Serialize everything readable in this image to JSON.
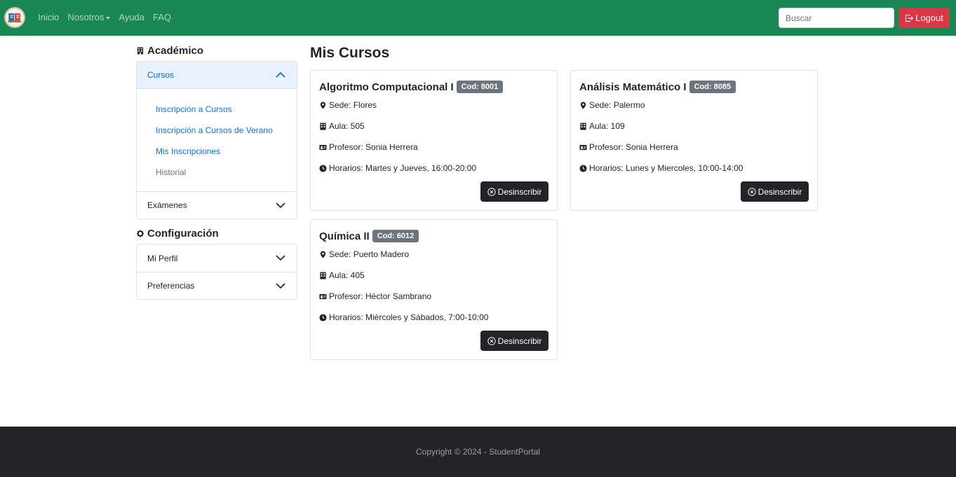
{
  "navbar": {
    "logo": "student-portal-logo",
    "links": [
      "Inicio",
      "Nosotros",
      "Ayuda",
      "FAQ"
    ],
    "search_placeholder": "Buscar",
    "logout_label": "Logout",
    "background": "#198754"
  },
  "sidebar": {
    "academico": {
      "title": "Académico",
      "cursos": {
        "label": "Cursos",
        "expanded": true,
        "items": [
          "Inscripción a Cursos",
          "Inscripción a Cursos de Verano",
          "Mis Inscripciones",
          "Historial"
        ]
      },
      "examenes": {
        "label": "Exámenes",
        "expanded": false
      }
    },
    "configuracion": {
      "title": "Configuración",
      "items": [
        {
          "label": "Mi Perfil",
          "expanded": false
        },
        {
          "label": "Preferencias",
          "expanded": false
        }
      ]
    }
  },
  "main": {
    "title": "Mis Cursos",
    "courses": [
      {
        "name": "Algoritmo Computacional I",
        "code": "Cod: 8001",
        "sede": "Sede: Flores",
        "aula": "Aula: 505",
        "profesor": "Profesor: Sonia Herrera",
        "horarios": "Horarios: Martes y Jueves, 16:00-20:00",
        "button": "Desinscribir"
      },
      {
        "name": "Análisis Matemático I",
        "code": "Cod: 8085",
        "sede": "Sede: Palermo",
        "aula": "Aula: 109",
        "profesor": "Profesor: Sonia Herrera",
        "horarios": "Horarios: Lunes y Miercoles, 10:00-14:00",
        "button": "Desinscribir"
      },
      {
        "name": "Química II",
        "code": "Cod: 6012",
        "sede": "Sede: Puerto Madero",
        "aula": "Aula: 405",
        "profesor": "Profesor: Héctor Sambrano",
        "horarios": "Horarios: Miércoles y Sábados, 7:00-10:00",
        "button": "Desinscribir"
      }
    ]
  },
  "footer": {
    "text": "Copyright © 2024 - StudentPortal"
  },
  "colors": {
    "accent": "#198754",
    "danger": "#dc3545",
    "dark": "#212529",
    "link": "#0d6efd"
  }
}
